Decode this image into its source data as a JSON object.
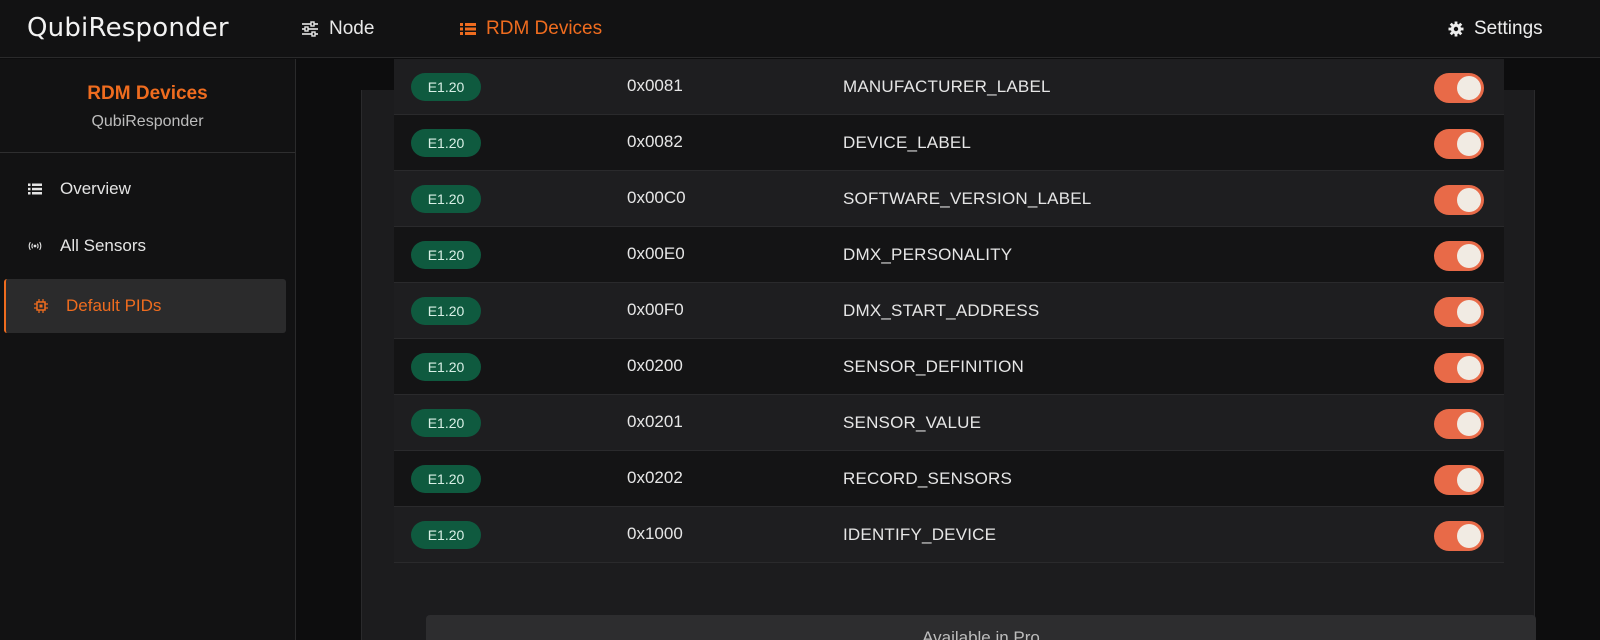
{
  "app": {
    "logo": "QubiResponder"
  },
  "topnav": {
    "node_label": "Node",
    "rdm_label": "RDM Devices",
    "settings_label": "Settings"
  },
  "sidebar": {
    "title": "RDM Devices",
    "subtitle": "QubiResponder",
    "items": [
      {
        "label": "Overview",
        "icon": "list-icon"
      },
      {
        "label": "All Sensors",
        "icon": "broadcast-icon"
      },
      {
        "label": "Default PIDs",
        "icon": "chip-icon",
        "active": true
      }
    ]
  },
  "table": {
    "rows": [
      {
        "standard": "E1.20",
        "pid": "0x0081",
        "name": "MANUFACTURER_LABEL",
        "enabled": true
      },
      {
        "standard": "E1.20",
        "pid": "0x0082",
        "name": "DEVICE_LABEL",
        "enabled": true
      },
      {
        "standard": "E1.20",
        "pid": "0x00C0",
        "name": "SOFTWARE_VERSION_LABEL",
        "enabled": true
      },
      {
        "standard": "E1.20",
        "pid": "0x00E0",
        "name": "DMX_PERSONALITY",
        "enabled": true
      },
      {
        "standard": "E1.20",
        "pid": "0x00F0",
        "name": "DMX_START_ADDRESS",
        "enabled": true
      },
      {
        "standard": "E1.20",
        "pid": "0x0200",
        "name": "SENSOR_DEFINITION",
        "enabled": true
      },
      {
        "standard": "E1.20",
        "pid": "0x0201",
        "name": "SENSOR_VALUE",
        "enabled": true
      },
      {
        "standard": "E1.20",
        "pid": "0x0202",
        "name": "RECORD_SENSORS",
        "enabled": true
      },
      {
        "standard": "E1.20",
        "pid": "0x1000",
        "name": "IDENTIFY_DEVICE",
        "enabled": true
      }
    ]
  },
  "pro_bar": {
    "label": "Available in Pro"
  },
  "colors": {
    "accent": "#ef6c1f",
    "toggle_on": "#e86a48",
    "badge_bg": "#0f5a3f"
  }
}
